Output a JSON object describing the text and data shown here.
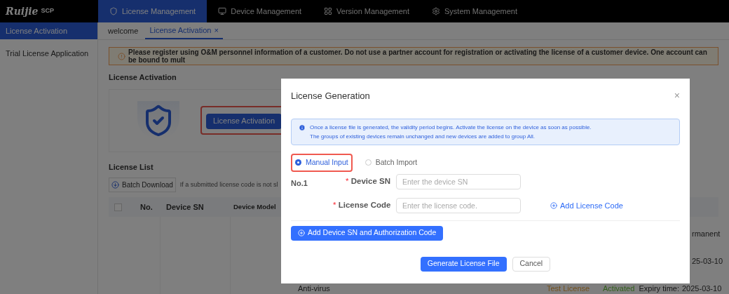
{
  "top_nav": {
    "logo": "Ruijie",
    "logo_suffix": "SCP",
    "items": [
      {
        "label": "License Management",
        "selected": true
      },
      {
        "label": "Device Management",
        "selected": false
      },
      {
        "label": "Version Management",
        "selected": false
      },
      {
        "label": "System Management",
        "selected": false
      }
    ]
  },
  "sidebar": {
    "items": [
      {
        "label": "License Activation",
        "selected": true
      },
      {
        "label": "Trial License Application",
        "selected": false
      }
    ]
  },
  "page_tabs": [
    {
      "label": "welcome",
      "selected": false
    },
    {
      "label": "License Activation",
      "selected": true,
      "close": "×"
    }
  ],
  "banner": {
    "text": "Please register using O&M personnel information of a customer. Do not use a partner account for registration or activating the license of a customer device. One account can be bound to mult"
  },
  "activation": {
    "title": "License Activation",
    "button": "License Activation",
    "highlighted": true
  },
  "license_list": {
    "title": "License List",
    "batch_download": "Batch Download",
    "hint": "If a submitted license code is not sl",
    "select_all_checked": false,
    "columns": [
      "No.",
      "Device SN",
      "Device Model"
    ],
    "rows": [
      {
        "expiry": "rmanent"
      },
      {
        "expiry": "25-03-10"
      },
      {
        "feature": "Anti-virus",
        "type": "Test License",
        "status": "Activated",
        "expiry_label": "Expiry time:",
        "expiry": "2025-03-10"
      }
    ]
  },
  "dialog": {
    "title": "License Generation",
    "close": "×",
    "alert": [
      "Once a license file is generated, the validity period begins. Activate the license on the device as soon as possible.",
      "The groups of existing devices remain unchanged and new devices are added to group All."
    ],
    "modes": [
      {
        "label": "Manual Input",
        "selected": true,
        "highlighted": true
      },
      {
        "label": "Batch Import",
        "selected": false,
        "highlighted": false
      }
    ],
    "entries": [
      {
        "number": "No.1",
        "device_sn": {
          "label": "Device SN",
          "required_mark": "*",
          "placeholder": "Enter the device SN"
        },
        "license_code": {
          "label": "License Code",
          "required_mark": "*",
          "placeholder": "Enter the license code."
        },
        "add_link": "Add License Code"
      }
    ],
    "add_button": "Add Device SN and Authorization Code",
    "buttons": [
      {
        "label": "Generate License File",
        "kind": "primary"
      },
      {
        "label": "Cancel",
        "kind": "default"
      }
    ]
  }
}
